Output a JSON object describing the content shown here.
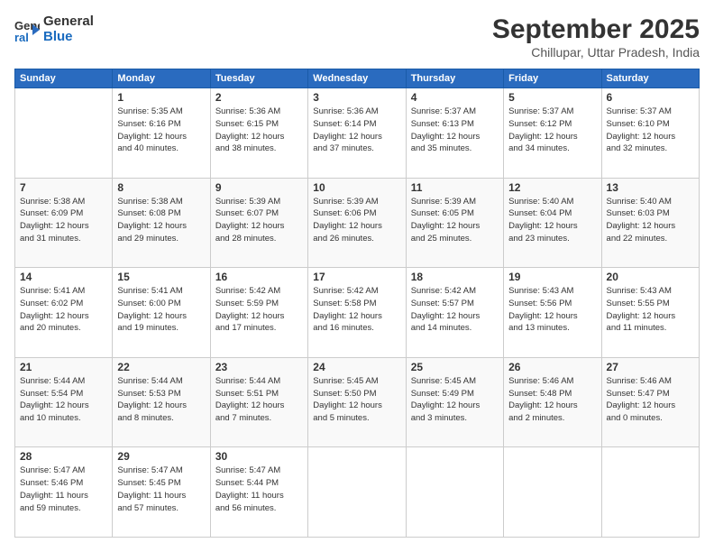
{
  "header": {
    "logo_line1": "General",
    "logo_line2": "Blue",
    "month": "September 2025",
    "location": "Chillupar, Uttar Pradesh, India"
  },
  "days_of_week": [
    "Sunday",
    "Monday",
    "Tuesday",
    "Wednesday",
    "Thursday",
    "Friday",
    "Saturday"
  ],
  "weeks": [
    [
      {
        "day": "",
        "info": ""
      },
      {
        "day": "1",
        "info": "Sunrise: 5:35 AM\nSunset: 6:16 PM\nDaylight: 12 hours\nand 40 minutes."
      },
      {
        "day": "2",
        "info": "Sunrise: 5:36 AM\nSunset: 6:15 PM\nDaylight: 12 hours\nand 38 minutes."
      },
      {
        "day": "3",
        "info": "Sunrise: 5:36 AM\nSunset: 6:14 PM\nDaylight: 12 hours\nand 37 minutes."
      },
      {
        "day": "4",
        "info": "Sunrise: 5:37 AM\nSunset: 6:13 PM\nDaylight: 12 hours\nand 35 minutes."
      },
      {
        "day": "5",
        "info": "Sunrise: 5:37 AM\nSunset: 6:12 PM\nDaylight: 12 hours\nand 34 minutes."
      },
      {
        "day": "6",
        "info": "Sunrise: 5:37 AM\nSunset: 6:10 PM\nDaylight: 12 hours\nand 32 minutes."
      }
    ],
    [
      {
        "day": "7",
        "info": "Sunrise: 5:38 AM\nSunset: 6:09 PM\nDaylight: 12 hours\nand 31 minutes."
      },
      {
        "day": "8",
        "info": "Sunrise: 5:38 AM\nSunset: 6:08 PM\nDaylight: 12 hours\nand 29 minutes."
      },
      {
        "day": "9",
        "info": "Sunrise: 5:39 AM\nSunset: 6:07 PM\nDaylight: 12 hours\nand 28 minutes."
      },
      {
        "day": "10",
        "info": "Sunrise: 5:39 AM\nSunset: 6:06 PM\nDaylight: 12 hours\nand 26 minutes."
      },
      {
        "day": "11",
        "info": "Sunrise: 5:39 AM\nSunset: 6:05 PM\nDaylight: 12 hours\nand 25 minutes."
      },
      {
        "day": "12",
        "info": "Sunrise: 5:40 AM\nSunset: 6:04 PM\nDaylight: 12 hours\nand 23 minutes."
      },
      {
        "day": "13",
        "info": "Sunrise: 5:40 AM\nSunset: 6:03 PM\nDaylight: 12 hours\nand 22 minutes."
      }
    ],
    [
      {
        "day": "14",
        "info": "Sunrise: 5:41 AM\nSunset: 6:02 PM\nDaylight: 12 hours\nand 20 minutes."
      },
      {
        "day": "15",
        "info": "Sunrise: 5:41 AM\nSunset: 6:00 PM\nDaylight: 12 hours\nand 19 minutes."
      },
      {
        "day": "16",
        "info": "Sunrise: 5:42 AM\nSunset: 5:59 PM\nDaylight: 12 hours\nand 17 minutes."
      },
      {
        "day": "17",
        "info": "Sunrise: 5:42 AM\nSunset: 5:58 PM\nDaylight: 12 hours\nand 16 minutes."
      },
      {
        "day": "18",
        "info": "Sunrise: 5:42 AM\nSunset: 5:57 PM\nDaylight: 12 hours\nand 14 minutes."
      },
      {
        "day": "19",
        "info": "Sunrise: 5:43 AM\nSunset: 5:56 PM\nDaylight: 12 hours\nand 13 minutes."
      },
      {
        "day": "20",
        "info": "Sunrise: 5:43 AM\nSunset: 5:55 PM\nDaylight: 12 hours\nand 11 minutes."
      }
    ],
    [
      {
        "day": "21",
        "info": "Sunrise: 5:44 AM\nSunset: 5:54 PM\nDaylight: 12 hours\nand 10 minutes."
      },
      {
        "day": "22",
        "info": "Sunrise: 5:44 AM\nSunset: 5:53 PM\nDaylight: 12 hours\nand 8 minutes."
      },
      {
        "day": "23",
        "info": "Sunrise: 5:44 AM\nSunset: 5:51 PM\nDaylight: 12 hours\nand 7 minutes."
      },
      {
        "day": "24",
        "info": "Sunrise: 5:45 AM\nSunset: 5:50 PM\nDaylight: 12 hours\nand 5 minutes."
      },
      {
        "day": "25",
        "info": "Sunrise: 5:45 AM\nSunset: 5:49 PM\nDaylight: 12 hours\nand 3 minutes."
      },
      {
        "day": "26",
        "info": "Sunrise: 5:46 AM\nSunset: 5:48 PM\nDaylight: 12 hours\nand 2 minutes."
      },
      {
        "day": "27",
        "info": "Sunrise: 5:46 AM\nSunset: 5:47 PM\nDaylight: 12 hours\nand 0 minutes."
      }
    ],
    [
      {
        "day": "28",
        "info": "Sunrise: 5:47 AM\nSunset: 5:46 PM\nDaylight: 11 hours\nand 59 minutes."
      },
      {
        "day": "29",
        "info": "Sunrise: 5:47 AM\nSunset: 5:45 PM\nDaylight: 11 hours\nand 57 minutes."
      },
      {
        "day": "30",
        "info": "Sunrise: 5:47 AM\nSunset: 5:44 PM\nDaylight: 11 hours\nand 56 minutes."
      },
      {
        "day": "",
        "info": ""
      },
      {
        "day": "",
        "info": ""
      },
      {
        "day": "",
        "info": ""
      },
      {
        "day": "",
        "info": ""
      }
    ]
  ]
}
